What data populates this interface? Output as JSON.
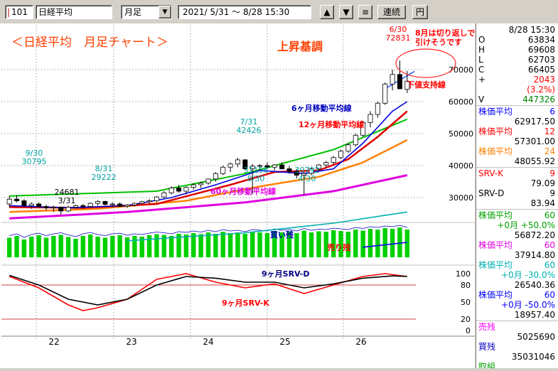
{
  "toolbar": {
    "code": "101",
    "name": "日経平均",
    "period": "月足",
    "date_range": "2021/ 5/31 ～  8/28 15:30",
    "up_label": "▲",
    "down_label": "▼",
    "menu_label": "≡",
    "link_label": "連続",
    "yen_label": "円"
  },
  "side": {
    "datetime": "8/28 15:30",
    "quote": [
      {
        "label": "O",
        "value": "63834",
        "color": "#000000"
      },
      {
        "label": "H",
        "value": "69608",
        "color": "#000000"
      },
      {
        "label": "L",
        "value": "62703",
        "color": "#000000"
      },
      {
        "label": "C",
        "value": "66405",
        "color": "#000000"
      },
      {
        "label": "+",
        "value": "2043",
        "color": "#ff0000"
      },
      {
        "label": "",
        "value": "(3.2%)",
        "color": "#ff0000"
      },
      {
        "label": "V",
        "value": "447326",
        "color": "#008000"
      }
    ],
    "ma": [
      {
        "label": "株価平均",
        "period": "6",
        "value": "62917.50",
        "color": "#0000ff",
        "sub": ""
      },
      {
        "label": "株価平均",
        "period": "12",
        "value": "57301.00",
        "color": "#ff0000",
        "sub": ""
      },
      {
        "label": "株価平均",
        "period": "24",
        "value": "48055.92",
        "color": "#ff8000",
        "sub": ""
      }
    ],
    "srv": [
      {
        "label": "SRV-K",
        "period": "9",
        "value": "79.09",
        "color": "#ff0000"
      },
      {
        "label": "SRV-D",
        "period": "9",
        "value": "83.94",
        "color": "#000000"
      }
    ],
    "ma_long": [
      {
        "label": "株価平均",
        "period": "60",
        "sub": "+0月 +50.0%",
        "value": "56872.20",
        "color": "#00a000"
      },
      {
        "label": "株価平均",
        "period": "60",
        "sub": "",
        "value": "37914.80",
        "color": "#e000e0"
      },
      {
        "label": "株価平均",
        "period": "60",
        "sub": "+0月 -30.0%",
        "value": "26540.36",
        "color": "#00b0b0"
      },
      {
        "label": "株価平均",
        "period": "60",
        "sub": "+0月 -50.0%",
        "value": "18957.40",
        "color": "#0000ff"
      }
    ],
    "sell_label": "売残",
    "sell_value": "5025690",
    "buy_label": "買残",
    "buy_value": "35031046",
    "last_label": "取組"
  },
  "annotations": {
    "title": "＜日経平均　月足チャート＞",
    "trend": "上昇基調",
    "note_line1": "8月は切り返しで",
    "note_line2": "引けそうです",
    "support": "下値支持線",
    "ma6": "6ヶ月移動平均線",
    "ma12": "12ヶ月移動平均線",
    "ma60": "60ヶ月移動平均線",
    "buy_rem": "買い残",
    "sell_rem": "売り残",
    "srvd": "9ヶ月SRV-D",
    "srvk": "9ヶ月SRV-K"
  },
  "chart_data": {
    "type": "candlestick",
    "x_ticks": [
      "22",
      "23",
      "24",
      "25",
      "26"
    ],
    "y_ticks": [
      "70000",
      "60000",
      "50000",
      "40000",
      "30000"
    ],
    "y_range": [
      20000,
      80000
    ],
    "osc_ticks": [
      "100",
      "80",
      "50",
      "20",
      "0"
    ],
    "osc_range": [
      0,
      100
    ],
    "price_labels": [
      {
        "date": "9/30",
        "price": "30795",
        "color": "#00a0a0"
      },
      {
        "date": "3/31",
        "price": "24681",
        "color": "#000000"
      },
      {
        "date": "8/31",
        "price": "29222",
        "color": "#00a0a0"
      },
      {
        "date": "7/31",
        "price": "42426",
        "color": "#00a0a0"
      },
      {
        "date": "8/30",
        "price": "31156",
        "color": "#00a0a0"
      },
      {
        "date": "4/30",
        "price": "30792",
        "color": "#00a0a0"
      },
      {
        "date": "6/30",
        "price": "72831",
        "color": "#ff0000"
      }
    ],
    "candles": [
      [
        28000,
        30500,
        27000,
        29500
      ],
      [
        29500,
        30795,
        28500,
        29000
      ],
      [
        29000,
        29500,
        27000,
        27500
      ],
      [
        27500,
        28500,
        26500,
        28000
      ],
      [
        28000,
        28500,
        27000,
        27200
      ],
      [
        27200,
        27800,
        26000,
        26800
      ],
      [
        26800,
        27500,
        25500,
        27000
      ],
      [
        27000,
        27200,
        24681,
        25800
      ],
      [
        25800,
        27500,
        25500,
        27000
      ],
      [
        27000,
        27800,
        26500,
        27500
      ],
      [
        27500,
        28000,
        26500,
        27200
      ],
      [
        27200,
        28500,
        27000,
        28200
      ],
      [
        28200,
        29222,
        27500,
        28800
      ],
      [
        28800,
        29000,
        27500,
        27900
      ],
      [
        27900,
        28500,
        27000,
        28000
      ],
      [
        28000,
        28500,
        27000,
        27300
      ],
      [
        27300,
        28000,
        26800,
        27700
      ],
      [
        27700,
        28500,
        27200,
        28200
      ],
      [
        28200,
        29000,
        27800,
        28700
      ],
      [
        28700,
        29500,
        28000,
        29000
      ],
      [
        29000,
        30500,
        28500,
        30200
      ],
      [
        30200,
        32000,
        29800,
        31500
      ],
      [
        31500,
        33500,
        31000,
        33000
      ],
      [
        33000,
        34000,
        31500,
        32000
      ],
      [
        32000,
        33500,
        31000,
        33200
      ],
      [
        33200,
        34500,
        32500,
        34000
      ],
      [
        34000,
        35000,
        33000,
        34500
      ],
      [
        34500,
        36000,
        34000,
        35800
      ],
      [
        35800,
        38000,
        35000,
        37500
      ],
      [
        37500,
        40000,
        37000,
        39500
      ],
      [
        39500,
        41000,
        38000,
        40500
      ],
      [
        40500,
        42426,
        39500,
        41800
      ],
      [
        41800,
        42000,
        38500,
        39000
      ],
      [
        39000,
        40500,
        31156,
        39800
      ],
      [
        39800,
        40500,
        38500,
        40000
      ],
      [
        40000,
        41000,
        39000,
        39500
      ],
      [
        39500,
        40500,
        38500,
        40200
      ],
      [
        40200,
        41000,
        38800,
        39000
      ],
      [
        39000,
        39800,
        37500,
        38200
      ],
      [
        38200,
        39000,
        36000,
        37000
      ],
      [
        37000,
        38000,
        30792,
        37500
      ],
      [
        37500,
        39500,
        37000,
        39000
      ],
      [
        39000,
        40500,
        38500,
        40200
      ],
      [
        40200,
        41500,
        39500,
        41000
      ],
      [
        41000,
        43000,
        40500,
        42500
      ],
      [
        42500,
        45000,
        42000,
        44500
      ],
      [
        44500,
        47000,
        44000,
        46500
      ],
      [
        46500,
        50000,
        46000,
        49500
      ],
      [
        49500,
        54000,
        49000,
        53500
      ],
      [
        53500,
        57000,
        52000,
        56000
      ],
      [
        56000,
        60000,
        55000,
        59500
      ],
      [
        59500,
        66000,
        59000,
        65500
      ],
      [
        65500,
        70000,
        63500,
        68500
      ],
      [
        68500,
        72831,
        65000,
        64000
      ],
      [
        63834,
        69608,
        62703,
        66405
      ]
    ],
    "volume": [
      0.55,
      0.6,
      0.5,
      0.58,
      0.62,
      0.55,
      0.6,
      0.63,
      0.57,
      0.52,
      0.6,
      0.64,
      0.58,
      0.55,
      0.6,
      0.62,
      0.56,
      0.6,
      0.58,
      0.62,
      0.65,
      0.63,
      0.6,
      0.66,
      0.64,
      0.68,
      0.65,
      0.7,
      0.66,
      0.72,
      0.68,
      0.7,
      0.66,
      0.72,
      0.7,
      0.68,
      0.74,
      0.7,
      0.72,
      0.68,
      0.75,
      0.7,
      0.73,
      0.72,
      0.76,
      0.74,
      0.72,
      0.78,
      0.75,
      0.8,
      0.78,
      0.82,
      0.8,
      0.84,
      0.78
    ],
    "ma6": [
      [
        0,
        27500
      ],
      [
        8,
        26800
      ],
      [
        16,
        27500
      ],
      [
        22,
        30000
      ],
      [
        28,
        34000
      ],
      [
        34,
        38500
      ],
      [
        40,
        37500
      ],
      [
        44,
        39000
      ],
      [
        48,
        47000
      ],
      [
        52,
        57000
      ],
      [
        54,
        60000
      ]
    ],
    "ma12": [
      [
        0,
        27000
      ],
      [
        10,
        26800
      ],
      [
        20,
        28000
      ],
      [
        30,
        34000
      ],
      [
        36,
        38000
      ],
      [
        42,
        38500
      ],
      [
        46,
        42000
      ],
      [
        50,
        49000
      ],
      [
        54,
        57000
      ]
    ],
    "ma24": [
      [
        0,
        25500
      ],
      [
        12,
        26500
      ],
      [
        24,
        29000
      ],
      [
        34,
        33500
      ],
      [
        42,
        36500
      ],
      [
        48,
        41000
      ],
      [
        54,
        48000
      ]
    ],
    "green_line": [
      [
        0,
        30500
      ],
      [
        20,
        32000
      ],
      [
        32,
        37500
      ],
      [
        44,
        45000
      ],
      [
        54,
        54500
      ]
    ],
    "magenta_line": [
      [
        0,
        23500
      ],
      [
        16,
        25500
      ],
      [
        32,
        28500
      ],
      [
        44,
        32000
      ],
      [
        54,
        37000
      ]
    ],
    "cyan_line": [
      [
        16,
        16500
      ],
      [
        32,
        19000
      ],
      [
        44,
        22000
      ],
      [
        54,
        25500
      ]
    ],
    "blue_line": [
      [
        48,
        14500
      ],
      [
        54,
        16000
      ]
    ],
    "support_line": [
      [
        51,
        64000
      ],
      [
        55,
        69500
      ]
    ],
    "srvk": [
      [
        0,
        95
      ],
      [
        4,
        75
      ],
      [
        8,
        45
      ],
      [
        10,
        35
      ],
      [
        12,
        40
      ],
      [
        16,
        55
      ],
      [
        20,
        90
      ],
      [
        24,
        100
      ],
      [
        28,
        85
      ],
      [
        32,
        75
      ],
      [
        36,
        82
      ],
      [
        40,
        65
      ],
      [
        44,
        80
      ],
      [
        48,
        95
      ],
      [
        51,
        100
      ],
      [
        54,
        95
      ]
    ],
    "srvd": [
      [
        0,
        97
      ],
      [
        4,
        80
      ],
      [
        8,
        55
      ],
      [
        12,
        45
      ],
      [
        16,
        55
      ],
      [
        20,
        80
      ],
      [
        24,
        95
      ],
      [
        28,
        92
      ],
      [
        32,
        85
      ],
      [
        36,
        85
      ],
      [
        40,
        75
      ],
      [
        44,
        82
      ],
      [
        48,
        92
      ],
      [
        52,
        96
      ],
      [
        54,
        95
      ]
    ]
  }
}
